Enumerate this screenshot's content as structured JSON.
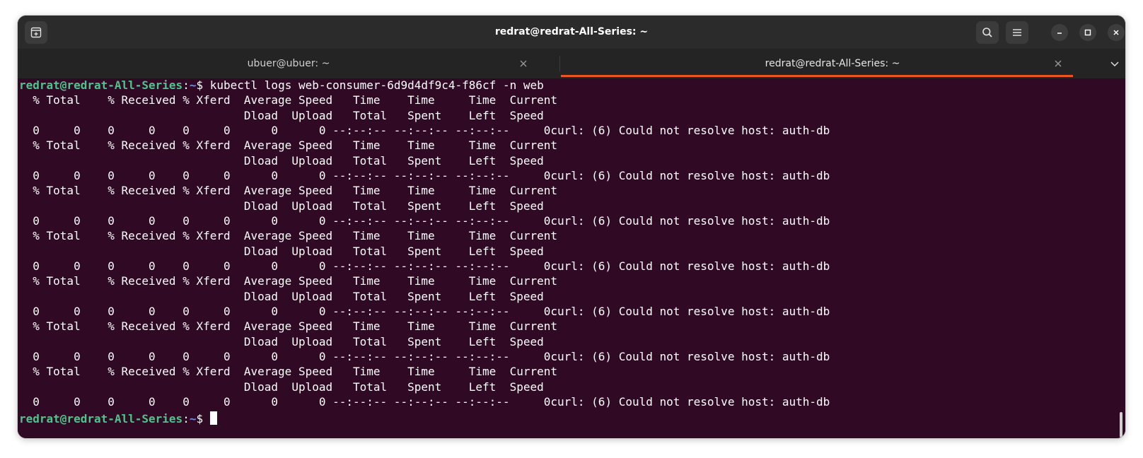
{
  "window": {
    "title": "redrat@redrat-All-Series: ~"
  },
  "tabs": [
    {
      "label": "ubuer@ubuer: ~",
      "active": false
    },
    {
      "label": "redrat@redrat-All-Series: ~",
      "active": true
    }
  ],
  "icons": {
    "new_tab": "new-tab-icon",
    "search": "search-icon",
    "menu": "hamburger-menu-icon",
    "minimize": "minimize-icon",
    "maximize": "maximize-icon",
    "close": "close-icon",
    "tab_close": "close-icon",
    "tabs_menu": "chevron-down-icon"
  },
  "colors": {
    "terminal_bg": "#300a24",
    "prompt_user": "#4ec48d",
    "prompt_path": "#6d8ff2",
    "active_tab_indicator": "#e95420"
  },
  "terminal": {
    "prompt_user": "redrat@redrat-All-Series",
    "prompt_sep": ":",
    "prompt_path": "~",
    "prompt_symbol": "$ ",
    "command": "kubectl logs web-consumer-6d9d4df9c4-f86cf -n web",
    "output_lines": [
      "  % Total    % Received % Xferd  Average Speed   Time    Time     Time  Current",
      "                                 Dload  Upload   Total   Spent    Left  Speed",
      "  0     0    0     0    0     0      0      0 --:--:-- --:--:-- --:--:--     0curl: (6) Could not resolve host: auth-db",
      "  % Total    % Received % Xferd  Average Speed   Time    Time     Time  Current",
      "                                 Dload  Upload   Total   Spent    Left  Speed",
      "  0     0    0     0    0     0      0      0 --:--:-- --:--:-- --:--:--     0curl: (6) Could not resolve host: auth-db",
      "  % Total    % Received % Xferd  Average Speed   Time    Time     Time  Current",
      "                                 Dload  Upload   Total   Spent    Left  Speed",
      "  0     0    0     0    0     0      0      0 --:--:-- --:--:-- --:--:--     0curl: (6) Could not resolve host: auth-db",
      "  % Total    % Received % Xferd  Average Speed   Time    Time     Time  Current",
      "                                 Dload  Upload   Total   Spent    Left  Speed",
      "  0     0    0     0    0     0      0      0 --:--:-- --:--:-- --:--:--     0curl: (6) Could not resolve host: auth-db",
      "  % Total    % Received % Xferd  Average Speed   Time    Time     Time  Current",
      "                                 Dload  Upload   Total   Spent    Left  Speed",
      "  0     0    0     0    0     0      0      0 --:--:-- --:--:-- --:--:--     0curl: (6) Could not resolve host: auth-db",
      "  % Total    % Received % Xferd  Average Speed   Time    Time     Time  Current",
      "                                 Dload  Upload   Total   Spent    Left  Speed",
      "  0     0    0     0    0     0      0      0 --:--:-- --:--:-- --:--:--     0curl: (6) Could not resolve host: auth-db",
      "  % Total    % Received % Xferd  Average Speed   Time    Time     Time  Current",
      "                                 Dload  Upload   Total   Spent    Left  Speed",
      "  0     0    0     0    0     0      0      0 --:--:-- --:--:-- --:--:--     0curl: (6) Could not resolve host: auth-db"
    ]
  }
}
